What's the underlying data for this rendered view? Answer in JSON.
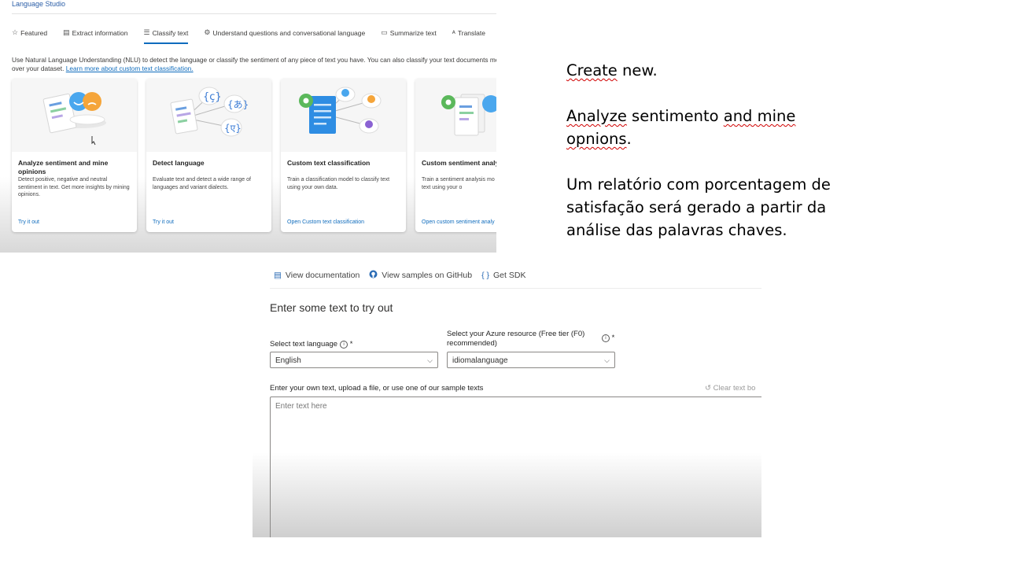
{
  "app": {
    "title": "Language Studio"
  },
  "tabs": [
    {
      "label": "Featured",
      "icon": "star-icon",
      "active": false
    },
    {
      "label": "Extract information",
      "icon": "document-icon",
      "active": false
    },
    {
      "label": "Classify text",
      "icon": "list-icon",
      "active": true
    },
    {
      "label": "Understand questions and conversational language",
      "icon": "bot-icon",
      "active": false
    },
    {
      "label": "Summarize text",
      "icon": "summary-icon",
      "active": false
    },
    {
      "label": "Translate",
      "icon": "translate-icon",
      "active": false
    }
  ],
  "intro": {
    "text": "Use Natural Language Understanding (NLU) to detect the language or classify the sentiment of any piece of text you have. You can also classify your text documents model over your dataset.",
    "link": "Learn more about custom text classification."
  },
  "cards": [
    {
      "title": "Analyze sentiment and mine opinions",
      "desc": "Detect positive, negative and neutral sentiment in text. Get more insights by mining opinions.",
      "link": "Try it out"
    },
    {
      "title": "Detect language",
      "desc": "Evaluate text and detect a wide range of languages and variant dialects.",
      "link": "Try it out"
    },
    {
      "title": "Custom text classification",
      "desc": "Train a classification model to classify text using your own data.",
      "link": "Open Custom text classification"
    },
    {
      "title": "Custom sentiment analys",
      "desc": "Train a sentiment analysis mo sentiment in text using your o",
      "link": "Open custom sentiment analy"
    }
  ],
  "notes": {
    "line1_a": "Create",
    "line1_b": " new.",
    "line2_a": "Analyze",
    "line2_b": " sentimento ",
    "line2_c": "and mine",
    "line2_d": "opnions",
    "line2_e": ".",
    "line3": "Um relatório com porcentagem de satisfação será gerado a partir da análise das palavras chaves."
  },
  "doc_links": [
    {
      "label": "View documentation",
      "icon": "document-icon"
    },
    {
      "label": "View samples on GitHub",
      "icon": "github-icon"
    },
    {
      "label": "Get SDK",
      "icon": "code-braces-icon"
    }
  ],
  "try_out": {
    "heading": "Enter some text to try out",
    "language_label": "Select text language",
    "language_value": "English",
    "resource_label": "Select your Azure resource (Free tier (F0) recommended)",
    "resource_value": "idiomalanguage",
    "required_mark": "*",
    "text_label": "Enter your own text, upload a file, or use one of our sample texts",
    "clear_label": "Clear text bo",
    "placeholder": "Enter text here"
  }
}
